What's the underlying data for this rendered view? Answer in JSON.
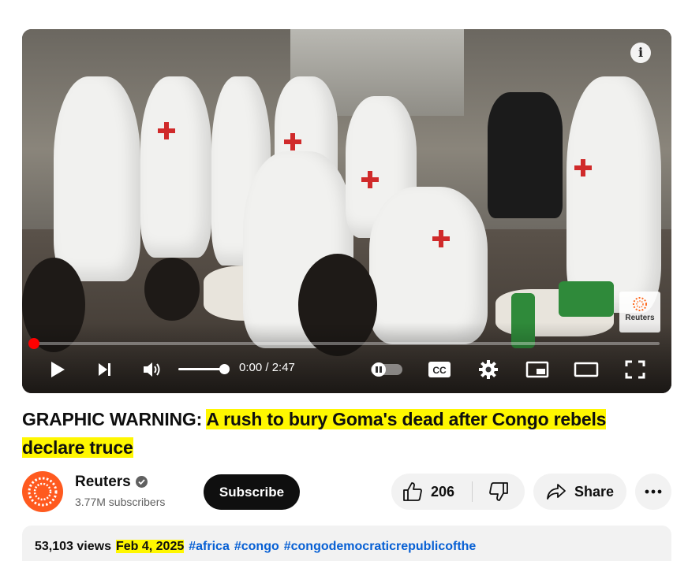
{
  "player": {
    "info_label": "i",
    "watermark_text": "Reuters",
    "progress_fraction": 0.0,
    "volume_fraction": 0.9,
    "time_current": "0:00",
    "time_total": "2:47",
    "time_display": "0:00 / 2:47",
    "icons": [
      "play-icon",
      "next-icon",
      "volume-icon",
      "autoplay-toggle-icon",
      "captions-icon",
      "settings-icon",
      "miniplayer-icon",
      "theater-icon",
      "fullscreen-icon"
    ],
    "cc_label": "CC"
  },
  "video": {
    "title_prefix": "GRAPHIC WARNING:",
    "title_highlight": "A rush to bury Goma's dead after Congo rebels declare truce"
  },
  "channel": {
    "name": "Reuters",
    "subscribers": "3.77M subscribers",
    "subscribe_label": "Subscribe"
  },
  "actions": {
    "like_count": "206",
    "share_label": "Share",
    "more_label": "⋯"
  },
  "description": {
    "views": "53,103 views",
    "date": "Feb 4, 2025",
    "hashtags": [
      "#africa",
      "#congo",
      "#congodemocraticrepublicofthe"
    ]
  },
  "colors": {
    "accent_red": "#ff0000",
    "highlight": "#fff700",
    "link": "#065fd4",
    "avatar": "#ff5a1f"
  }
}
